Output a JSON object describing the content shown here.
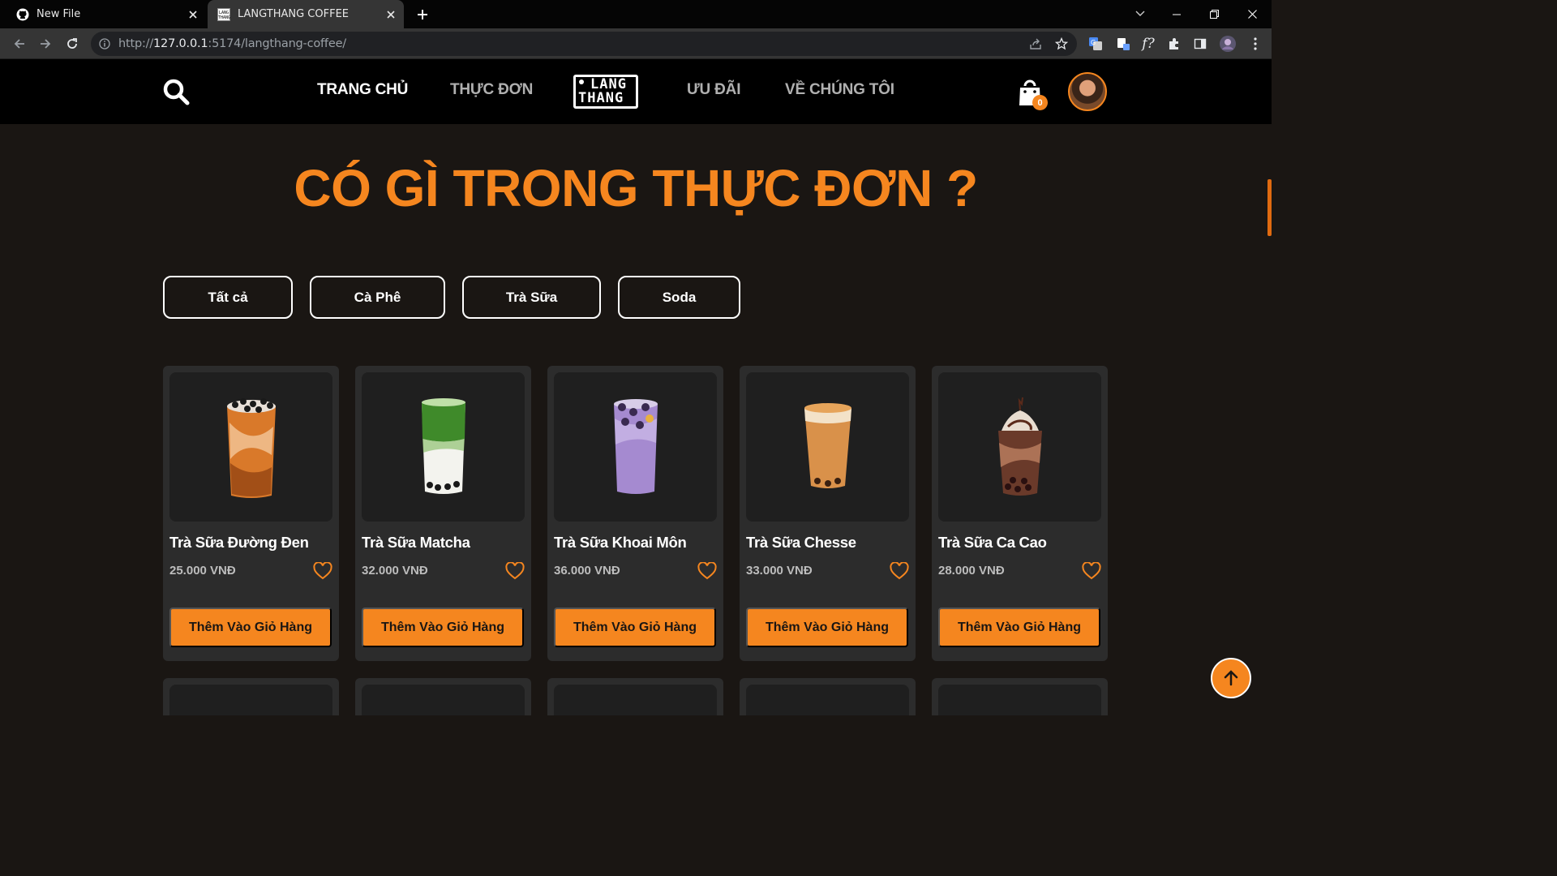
{
  "browser": {
    "tabs": [
      {
        "title": "New File",
        "icon": "github-icon",
        "active": false
      },
      {
        "title": "LANGTHANG COFFEE",
        "icon": "langthang-favicon",
        "active": true
      }
    ],
    "url_prefix": "http://",
    "url_host": "127.0.0.1",
    "url_rest": ":5174/langthang-coffee/"
  },
  "nav": {
    "links": [
      "TRANG CHỦ",
      "THỰC ĐƠN",
      "ƯU ĐÃI",
      "VỀ CHÚNG TÔI"
    ],
    "active": "TRANG CHỦ",
    "logo_top": "LANG",
    "logo_bottom": "THANG",
    "cart_count": "0"
  },
  "menu": {
    "heading": "CÓ GÌ TRONG THỰC ĐƠN ?",
    "filters": [
      "Tất cả",
      "Cà Phê",
      "Trà Sữa",
      "Soda"
    ],
    "products": [
      {
        "name": "Trà Sữa Đường Đen",
        "price": "25.000 VNĐ",
        "button": "Thêm Vào Giỏ Hàng"
      },
      {
        "name": "Trà Sữa Matcha",
        "price": "32.000 VNĐ",
        "button": "Thêm Vào Giỏ Hàng"
      },
      {
        "name": "Trà Sữa Khoai Môn",
        "price": "36.000 VNĐ",
        "button": "Thêm Vào Giỏ Hàng"
      },
      {
        "name": "Trà Sữa Chesse",
        "price": "33.000 VNĐ",
        "button": "Thêm Vào Giỏ Hàng"
      },
      {
        "name": "Trà Sữa Ca Cao",
        "price": "28.000 VNĐ",
        "button": "Thêm Vào Giỏ Hàng"
      }
    ]
  },
  "colors": {
    "accent": "#f5861f",
    "background": "#1a1613",
    "card": "#2c2c2c"
  }
}
